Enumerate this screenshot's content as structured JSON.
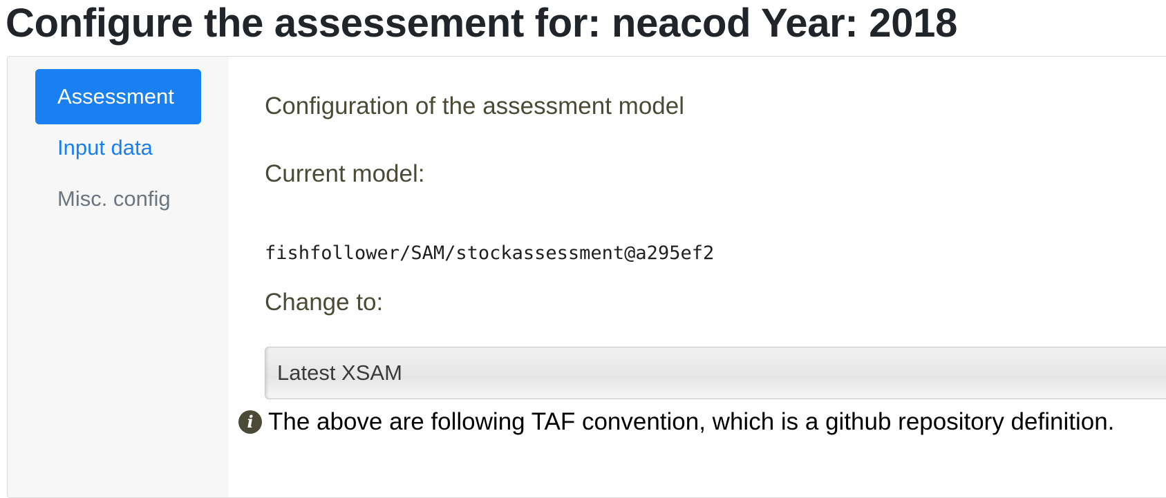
{
  "header": {
    "prefix": "Configure the assessement for: ",
    "stock": "neacod",
    "year_label": " Year: ",
    "year": "2018"
  },
  "sidebar": {
    "items": [
      {
        "label": "Assessment",
        "state": "active"
      },
      {
        "label": "Input data",
        "state": "link"
      },
      {
        "label": "Misc. config",
        "state": "muted"
      }
    ]
  },
  "main": {
    "section_title": "Configuration of the assessment model",
    "current_model_label": "Current model:",
    "current_model_value": "fishfollower/SAM/stockassessment@a295ef2",
    "change_to_label": "Change to:",
    "change_to_selected": "Latest XSAM",
    "info_icon": "info-circle-icon",
    "info_text": "The above are following TAF convention, which is a github repository definition."
  },
  "colors": {
    "accent": "#1a7ff0",
    "text_olive": "#4a4a36",
    "sidebar_bg": "#f7f7f7"
  }
}
